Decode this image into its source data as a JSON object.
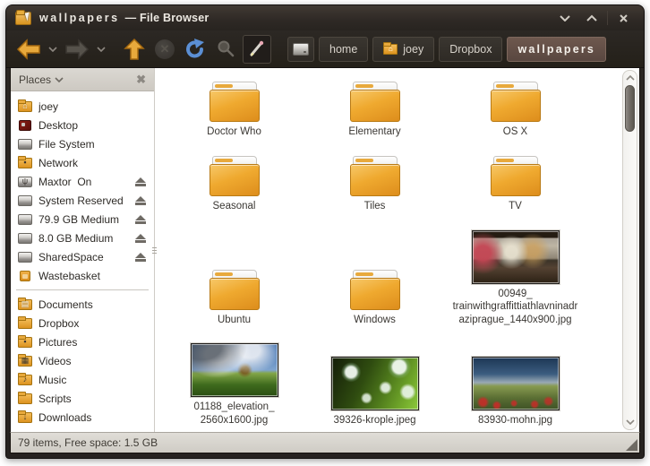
{
  "window": {
    "title_name": "wallpapers",
    "title_suffix": "— File Browser"
  },
  "toolbar": {
    "path": {
      "home": "home",
      "user": "joey",
      "dropbox": "Dropbox",
      "current": "wallpapers"
    },
    "colors": {
      "accent_arrow": "#e8a93c",
      "refresh_blue": "#5b8fd4",
      "active_path_bg": "#5f4d45"
    }
  },
  "sidebar": {
    "header": "Places",
    "items": [
      {
        "label": "joey",
        "icon": "home-folder-icon",
        "eject": false
      },
      {
        "label": "Desktop",
        "icon": "desktop-icon",
        "eject": false
      },
      {
        "label": "File System",
        "icon": "drive-icon",
        "eject": false
      },
      {
        "label": "Network",
        "icon": "network-folder-icon",
        "eject": false
      },
      {
        "label": "Maxtor  On",
        "icon": "usb-drive-icon",
        "eject": true
      },
      {
        "label": "System Reserved",
        "icon": "drive-icon",
        "eject": true
      },
      {
        "label": "79.9 GB Medium",
        "icon": "drive-icon",
        "eject": true
      },
      {
        "label": "8.0 GB Medium",
        "icon": "drive-icon",
        "eject": true
      },
      {
        "label": "SharedSpace",
        "icon": "drive-icon",
        "eject": true
      },
      {
        "label": "Wastebasket",
        "icon": "trash-icon",
        "eject": false
      },
      {
        "label": "Documents",
        "icon": "documents-folder-icon",
        "eject": false
      },
      {
        "label": "Dropbox",
        "icon": "folder-icon",
        "eject": false
      },
      {
        "label": "Pictures",
        "icon": "pictures-folder-icon",
        "eject": false
      },
      {
        "label": "Videos",
        "icon": "videos-folder-icon",
        "eject": false
      },
      {
        "label": "Music",
        "icon": "music-folder-icon",
        "eject": false
      },
      {
        "label": "Scripts",
        "icon": "folder-icon",
        "eject": false
      },
      {
        "label": "Downloads",
        "icon": "downloads-folder-icon",
        "eject": false
      }
    ]
  },
  "main": {
    "items": [
      {
        "name": "Doctor Who",
        "type": "folder"
      },
      {
        "name": "Elementary",
        "type": "folder"
      },
      {
        "name": "OS X",
        "type": "folder"
      },
      {
        "name": "Seasonal",
        "type": "folder"
      },
      {
        "name": "Tiles",
        "type": "folder"
      },
      {
        "name": "TV",
        "type": "folder"
      },
      {
        "name": "Ubuntu",
        "type": "folder"
      },
      {
        "name": "Windows",
        "type": "folder"
      },
      {
        "name": "00949_ trainwithgraffittiathlavninadr aziprague_1440x900.jpg",
        "type": "image-train"
      },
      {
        "name": "01188_elevation_ 2560x1600.jpg",
        "type": "image-landscape"
      },
      {
        "name": "39326-krople.jpeg",
        "type": "image-droplets"
      },
      {
        "name": "83930-mohn.jpg",
        "type": "image-poppy-field"
      }
    ]
  },
  "statusbar": {
    "text": "79 items, Free space: 1.5 GB"
  }
}
